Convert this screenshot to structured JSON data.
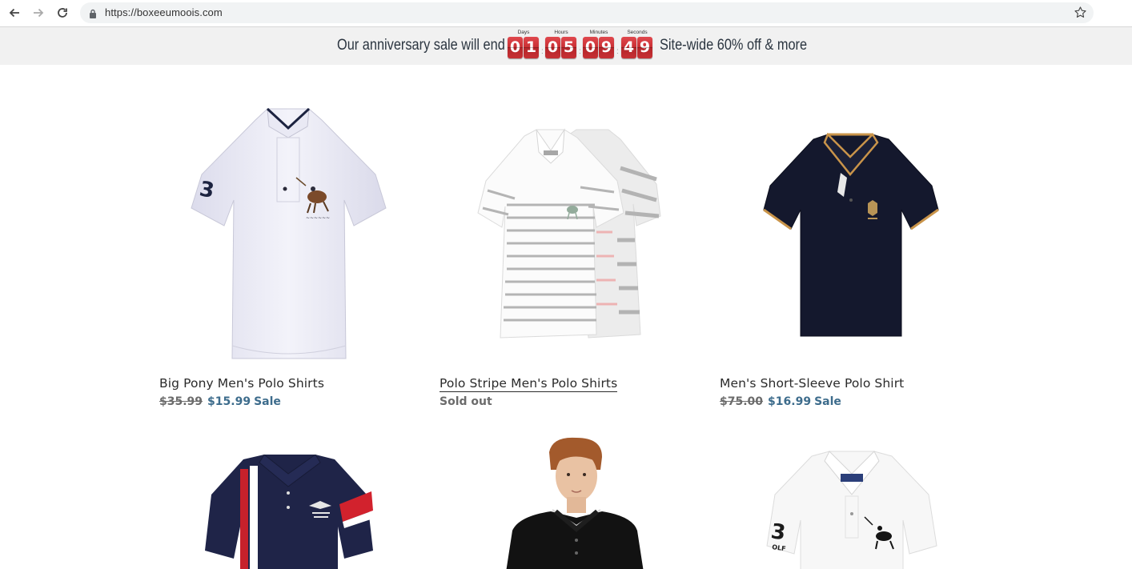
{
  "browser": {
    "url": "https://boxeeumoois.com"
  },
  "announcement": {
    "text_before": "Our anniversary sale will end in",
    "text_after": "Site-wide 60% off & more",
    "countdown": [
      {
        "label": "Days",
        "digits": [
          "0",
          "1"
        ]
      },
      {
        "label": "Hours",
        "digits": [
          "0",
          "5"
        ]
      },
      {
        "label": "Minutes",
        "digits": [
          "0",
          "9"
        ]
      },
      {
        "label": "Seconds",
        "digits": [
          "4",
          "9"
        ]
      }
    ],
    "accent_color": "#c92f33"
  },
  "products": [
    {
      "title": "Big Pony Men's Polo Shirts",
      "compare_price": "$35.99",
      "price": "$15.99",
      "badge": "Sale",
      "image": "white-polo-shirt"
    },
    {
      "title": "Polo Stripe Men's Polo Shirts",
      "status": "Sold out",
      "image": "striped-polo-shirt"
    },
    {
      "title": "Men's Short-Sleeve Polo Shirt",
      "compare_price": "$75.00",
      "price": "$16.99",
      "badge": "Sale",
      "image": "navy-polo-shirt"
    },
    {
      "image": "navy-racing-polo-shirt"
    },
    {
      "image": "model-black-polo-shirt"
    },
    {
      "image": "white-number-polo-shirt"
    }
  ]
}
